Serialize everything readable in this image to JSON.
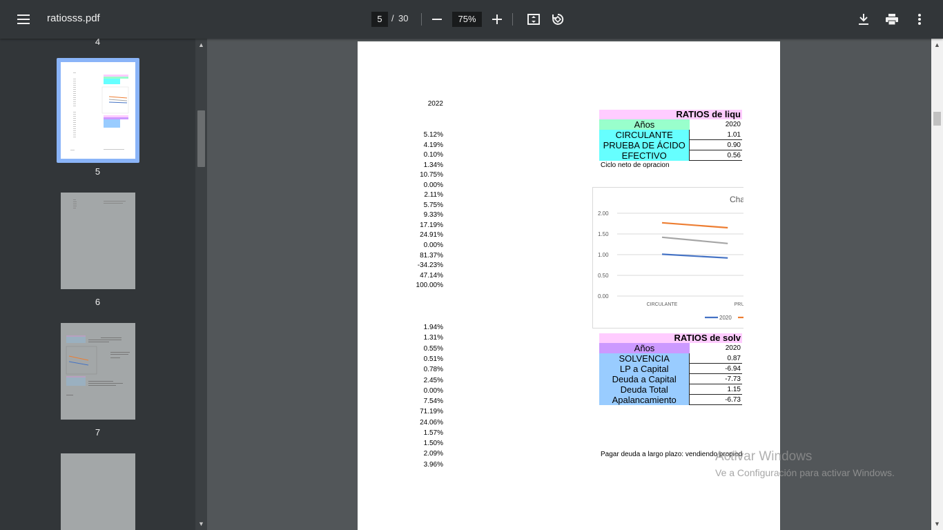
{
  "toolbar": {
    "title": "ratiosss.pdf",
    "page_current": "5",
    "page_separator": "/",
    "page_total": "30",
    "zoom": "75%"
  },
  "sidebar": {
    "thumb_numbers": [
      "4",
      "5",
      "6",
      "7"
    ],
    "active_page": "5"
  },
  "document": {
    "year_header": "2022",
    "percentages_group1": [
      "5.12%",
      "4.19%",
      "0.10%",
      "1.34%",
      "10.75%",
      "0.00%",
      "2.11%",
      "5.75%",
      "9.33%",
      "17.19%",
      "24.91%",
      "0.00%",
      "81.37%",
      "-34.23%",
      "47.14%",
      "100.00%"
    ],
    "percentages_group2": [
      "1.94%",
      "1.31%",
      "0.55%",
      "0.51%",
      "0.78%",
      "2.45%",
      "0.00%",
      "7.54%",
      "71.19%",
      "24.06%",
      "1.57%",
      "1.50%",
      "2.09%",
      "3.96%"
    ],
    "liquidity_table": {
      "title": "RATIOS de liqu",
      "header_label": "Años",
      "header_year": "2020",
      "rows": [
        {
          "label": "CIRCULANTE",
          "value": "1.01"
        },
        {
          "label": "PRUEBA DE ÁCIDO",
          "value": "0.90"
        },
        {
          "label": "EFECTIVO",
          "value": "0.56"
        }
      ],
      "note": "Ciclo neto de opracion"
    },
    "solvency_table": {
      "title": "RATIOS de solv",
      "header_label": "Años",
      "header_year": "2020",
      "rows": [
        {
          "label": "SOLVENCIA",
          "value": "0.87"
        },
        {
          "label": "LP a Capital",
          "value": "-6.94"
        },
        {
          "label": "Deuda a Capital",
          "value": "-7.73"
        },
        {
          "label": "Deuda Total",
          "value": "1.15"
        },
        {
          "label": "Apalancamiento",
          "value": "-6.73"
        }
      ]
    },
    "footer_note": "Pagar deuda a largo plazo: vendiendo propied"
  },
  "chart_data": {
    "type": "line",
    "title": "Cha",
    "categories": [
      "CIRCULANTE",
      "PRU"
    ],
    "ylim": [
      0,
      2
    ],
    "yticks": [
      "0.00",
      "0.50",
      "1.00",
      "1.50",
      "2.00"
    ],
    "grid": true,
    "legend": "bottom",
    "series": [
      {
        "name": "2020",
        "color": "#4472c4",
        "values": [
          1.01,
          0.92
        ]
      },
      {
        "color": "#ed7d31",
        "values": [
          1.77,
          1.65
        ]
      },
      {
        "color": "#a5a5a5",
        "values": [
          1.42,
          1.27
        ]
      }
    ]
  },
  "watermark": {
    "line1": "Activar Windows",
    "line2": "Ve a Configuración para activar Windows."
  },
  "colors": {
    "toolbar_bg": "#323639",
    "viewer_bg": "#525659",
    "liquidity_title_bg": "#ffccff",
    "liquidity_header_bg": "#99ffcc",
    "liquidity_label_bg": "#66ffff",
    "solvency_title_bg": "#ffccff",
    "solvency_header_bg": "#cc99ff",
    "solvency_label_bg": "#99ccff",
    "selection": "#8ab4f8"
  }
}
